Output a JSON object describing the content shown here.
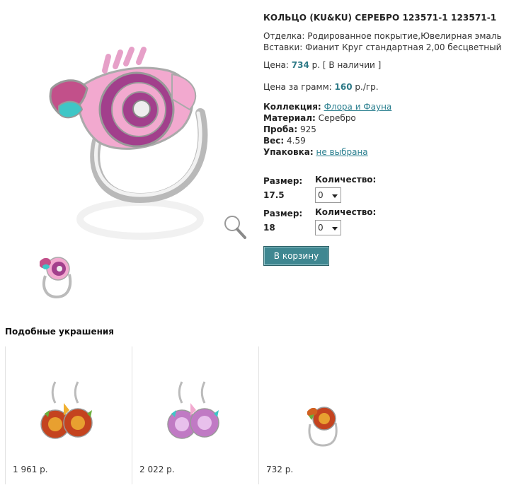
{
  "product": {
    "title": "КОЛЬЦО (KU&KU) СЕРЕБРО 123571-1 123571-1",
    "finish_label": "Отделка:",
    "finish_value": "Родированное покрытие,Ювелирная эмаль",
    "inserts_label": "Вставки:",
    "inserts_value": "Фианит Круг стандартная 2,00 бесцветный",
    "price_label": "Цена:",
    "price_value": "734",
    "price_suffix": "р. [ В наличии ]",
    "gram_label": "Цена за грамм:",
    "gram_value": "160",
    "gram_suffix": "р./гр.",
    "collection_label": "Коллекция:",
    "collection_value": "Флора и Фауна",
    "material_label": "Материал:",
    "material_value": "Серебро",
    "probe_label": "Проба:",
    "probe_value": "925",
    "weight_label": "Вес:",
    "weight_value": "4.59",
    "packaging_label": "Упаковка:",
    "packaging_value": "не выбрана"
  },
  "sizes": [
    {
      "size_label": "Размер:",
      "size_value": "17.5",
      "qty_label": "Количество:",
      "qty_value": "0"
    },
    {
      "size_label": "Размер:",
      "size_value": "18",
      "qty_label": "Количество:",
      "qty_value": "0"
    }
  ],
  "cart_button": "В корзину",
  "similar": {
    "title": "Подобные украшения",
    "items": [
      {
        "price": "1 961 р."
      },
      {
        "price": "2 022 р."
      },
      {
        "price": "732 р."
      }
    ]
  },
  "colors": {
    "accent": "#2e7a87",
    "button": "#3f8791",
    "enamel_pink": "#f2a9cf",
    "enamel_purple": "#a23f8c",
    "enamel_turquoise": "#3fc6c6"
  },
  "icons": {
    "zoom": "magnifier-icon"
  }
}
